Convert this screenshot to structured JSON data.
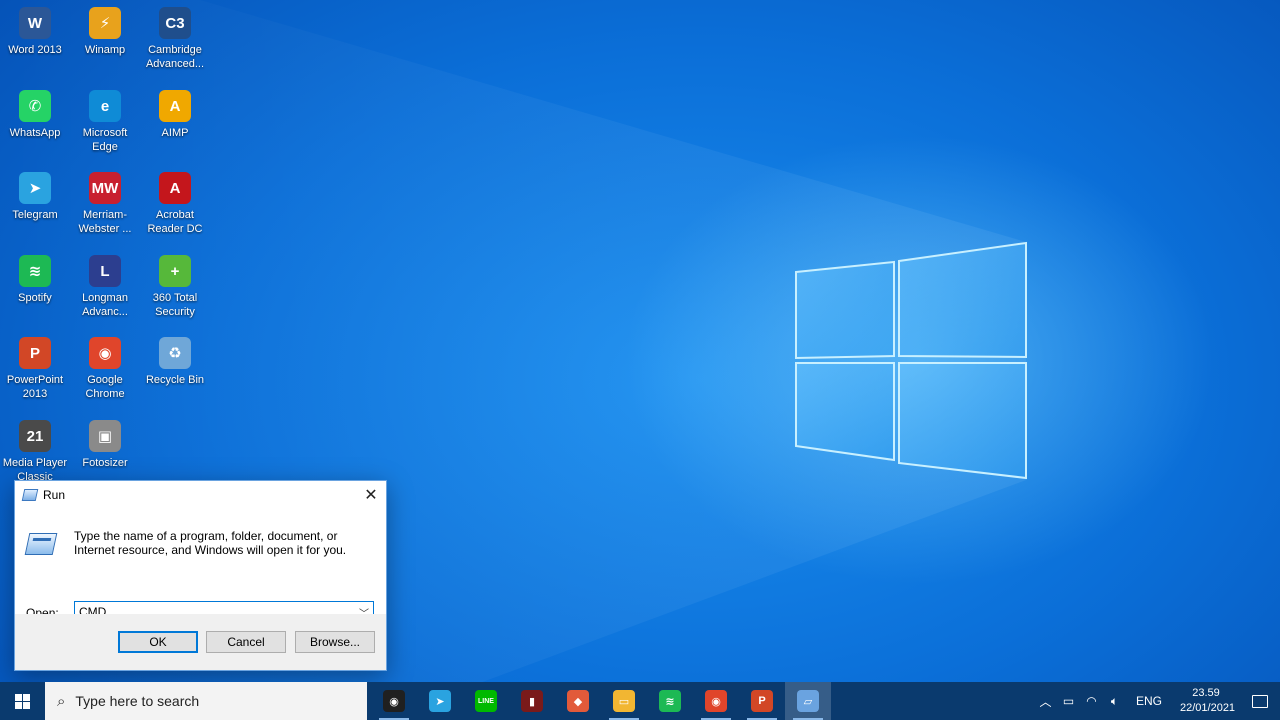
{
  "desktop": {
    "icons": [
      {
        "label": "Word 2013",
        "glyph": "W",
        "color": "#2b5797",
        "icon": "word-icon"
      },
      {
        "label": "WhatsApp",
        "glyph": "✆",
        "color": "#25d366",
        "icon": "whatsapp-icon"
      },
      {
        "label": "Telegram",
        "glyph": "➤",
        "color": "#2aa3e0",
        "icon": "telegram-icon"
      },
      {
        "label": "Spotify",
        "glyph": "≋",
        "color": "#1db954",
        "icon": "spotify-icon"
      },
      {
        "label": "PowerPoint\n2013",
        "glyph": "P",
        "color": "#d24726",
        "icon": "powerpoint-icon"
      },
      {
        "label": "Media Player\nClassic",
        "glyph": "21",
        "color": "#4a4a4a",
        "icon": "media-player-icon"
      },
      {
        "label": "Winamp",
        "glyph": "⚡",
        "color": "#e8a21c",
        "icon": "winamp-icon"
      },
      {
        "label": "Microsoft\nEdge",
        "glyph": "e",
        "color": "#0f8bd6",
        "icon": "edge-icon"
      },
      {
        "label": "Merriam-\nWebster ...",
        "glyph": "MW",
        "color": "#c8202f",
        "icon": "merriam-webster-icon"
      },
      {
        "label": "Longman\nAdvanc...",
        "glyph": "L",
        "color": "#2c3e8f",
        "icon": "longman-icon"
      },
      {
        "label": "Google\nChrome",
        "glyph": "◉",
        "color": "#e0452b",
        "icon": "chrome-icon"
      },
      {
        "label": "Fotosizer",
        "glyph": "▣",
        "color": "#8a8a8a",
        "icon": "fotosizer-icon"
      },
      {
        "label": "Cambridge\nAdvanced...",
        "glyph": "C3",
        "color": "#1f4e8c",
        "icon": "cambridge-icon"
      },
      {
        "label": "AIMP",
        "glyph": "A",
        "color": "#f0a800",
        "icon": "aimp-icon"
      },
      {
        "label": "Acrobat\nReader DC",
        "glyph": "A",
        "color": "#c4161c",
        "icon": "acrobat-icon"
      },
      {
        "label": "360 Total\nSecurity",
        "glyph": "+",
        "color": "#56b83a",
        "icon": "360-security-icon"
      },
      {
        "label": "Recycle Bin",
        "glyph": "♻",
        "color": "#6fa7d8",
        "icon": "recycle-bin-icon"
      }
    ]
  },
  "run_dialog": {
    "title": "Run",
    "description": "Type the name of a program, folder, document, or Internet resource, and Windows will open it for you.",
    "open_label_prefix": "O",
    "open_label_suffix": "pen:",
    "open_value": "CMD",
    "ok_label": "OK",
    "cancel_label": "Cancel",
    "browse_label": "Browse...",
    "close_glyph": "✕"
  },
  "taskbar": {
    "search_placeholder": "Type here to search",
    "apps": [
      {
        "name": "obs",
        "glyph": "◉",
        "color": "#202020",
        "running": true,
        "active": false
      },
      {
        "name": "telegram",
        "glyph": "➤",
        "color": "#2aa3e0",
        "running": false,
        "active": false
      },
      {
        "name": "line",
        "glyph": "LINE",
        "color": "#00b900",
        "running": false,
        "active": false
      },
      {
        "name": "book",
        "glyph": "▮",
        "color": "#7a1a1a",
        "running": false,
        "active": false
      },
      {
        "name": "eraser",
        "glyph": "◆",
        "color": "#e25a3a",
        "running": false,
        "active": false
      },
      {
        "name": "file-explorer",
        "glyph": "▭",
        "color": "#f2b632",
        "running": true,
        "active": false
      },
      {
        "name": "spotify",
        "glyph": "≋",
        "color": "#1db954",
        "running": false,
        "active": false
      },
      {
        "name": "chrome",
        "glyph": "◉",
        "color": "#e0452b",
        "running": true,
        "active": false
      },
      {
        "name": "powerpoint",
        "glyph": "P",
        "color": "#d24726",
        "running": true,
        "active": false
      },
      {
        "name": "run",
        "glyph": "▱",
        "color": "#6aa3e0",
        "running": true,
        "active": true
      }
    ],
    "tray": {
      "language": "ENG",
      "time": "23.59",
      "date": "22/01/2021"
    }
  }
}
